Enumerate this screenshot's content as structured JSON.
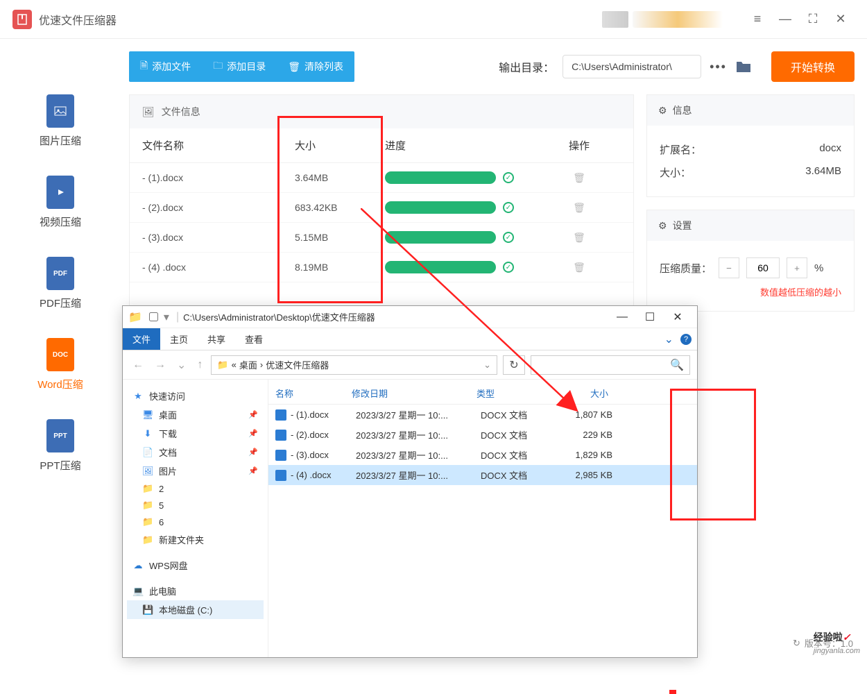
{
  "app": {
    "title": "优速文件压缩器"
  },
  "window_controls": {
    "menu": "≡",
    "min": "—",
    "max": "⛶",
    "close": "✕"
  },
  "sidebar": {
    "items": [
      {
        "label": "图片压缩",
        "icon": "IMG"
      },
      {
        "label": "视频压缩",
        "icon": "▶"
      },
      {
        "label": "PDF压缩",
        "icon": "PDF"
      },
      {
        "label": "Word压缩",
        "icon": "DOC",
        "active": true
      },
      {
        "label": "PPT压缩",
        "icon": "PPT"
      }
    ]
  },
  "toolbar": {
    "add_file": "添加文件",
    "add_folder": "添加目录",
    "clear_list": "清除列表",
    "output_label": "输出目录：",
    "output_path": "C:\\Users\\Administrator\\",
    "start": "开始转换"
  },
  "file_panel": {
    "header": "文件信息",
    "cols": {
      "name": "文件名称",
      "size": "大小",
      "progress": "进度",
      "action": "操作"
    },
    "rows": [
      {
        "name": "- (1).docx",
        "size": "3.64MB"
      },
      {
        "name": "- (2).docx",
        "size": "683.42KB"
      },
      {
        "name": "- (3).docx",
        "size": "5.15MB"
      },
      {
        "name": "- (4) .docx",
        "size": "8.19MB"
      }
    ]
  },
  "info_panel": {
    "header": "信息",
    "ext_label": "扩展名：",
    "ext_value": "docx",
    "size_label": "大小：",
    "size_value": "3.64MB"
  },
  "settings_panel": {
    "header": "设置",
    "quality_label": "压缩质量：",
    "quality_value": "60",
    "percent": "%",
    "hint": "数值越低压缩的越小"
  },
  "explorer": {
    "title_path": "C:\\Users\\Administrator\\Desktop\\优速文件压缩器",
    "ribbon": {
      "file": "文件",
      "home": "主页",
      "share": "共享",
      "view": "查看"
    },
    "breadcrumb": [
      "«",
      "桌面",
      "›",
      "优速文件压缩器"
    ],
    "tree": {
      "quick": "快速访问",
      "desktop": "桌面",
      "downloads": "下载",
      "documents": "文档",
      "pictures": "图片",
      "f2": "2",
      "f5": "5",
      "f6": "6",
      "newfolder": "新建文件夹",
      "wps": "WPS网盘",
      "thispc": "此电脑",
      "cdrive": "本地磁盘 (C:)"
    },
    "cols": {
      "name": "名称",
      "date": "修改日期",
      "type": "类型",
      "size": "大小"
    },
    "files": [
      {
        "name": "- (1).docx",
        "date": "2023/3/27 星期一 10:...",
        "type": "DOCX 文档",
        "size": "1,807 KB"
      },
      {
        "name": "- (2).docx",
        "date": "2023/3/27 星期一 10:...",
        "type": "DOCX 文档",
        "size": "229 KB"
      },
      {
        "name": "- (3).docx",
        "date": "2023/3/27 星期一 10:...",
        "type": "DOCX 文档",
        "size": "1,829 KB"
      },
      {
        "name": "- (4) .docx",
        "date": "2023/3/27 星期一 10:...",
        "type": "DOCX 文档",
        "size": "2,985 KB"
      }
    ]
  },
  "footer": {
    "version": "版本号：1.0"
  },
  "watermark": {
    "text1": "经验啦",
    "text2": "jingyanla.com"
  }
}
